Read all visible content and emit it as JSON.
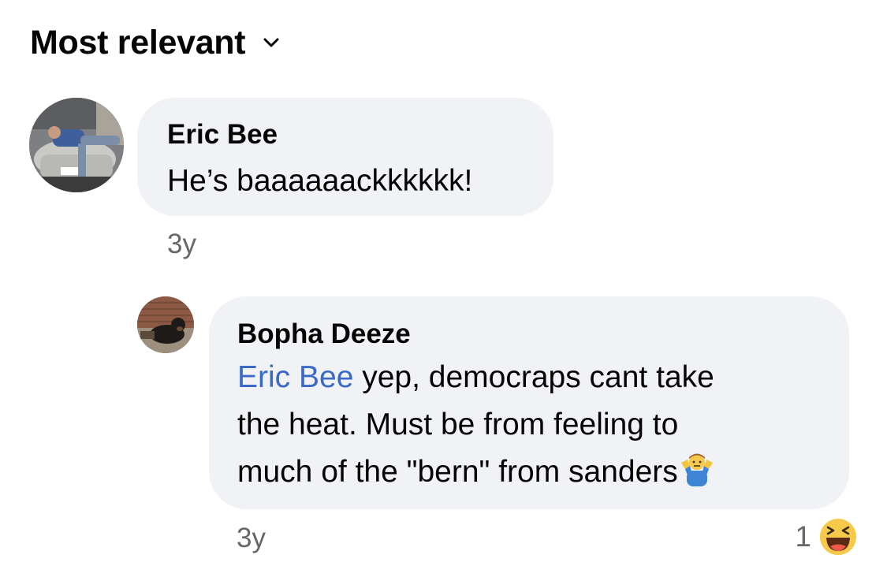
{
  "header": {
    "sort_label": "Most relevant",
    "sort_icon": "chevron-down-icon"
  },
  "comments": [
    {
      "author": "Eric Bee",
      "text": "He’s baaaaaackkkkkk!",
      "time": "3y",
      "avatar_icon": "avatar-photo-man-on-car"
    }
  ],
  "replies": [
    {
      "author": "Bopha Deeze",
      "mention": "Eric Bee",
      "line1_rest": " yep, democraps cant take",
      "line2": "the heat.  Must be from feeling to",
      "line3": "much of the \"bern\" from sanders",
      "emoji_icon": "man-shrugging-emoji",
      "time": "3y",
      "reaction_count": "1",
      "reaction_icon": "haha-reaction-icon",
      "avatar_icon": "avatar-photo-dog"
    }
  ],
  "colors": {
    "bubble_bg": "#f0f2f5",
    "mention_link": "#3b69c7",
    "meta_text": "#65676b",
    "primary_text": "#050505"
  }
}
